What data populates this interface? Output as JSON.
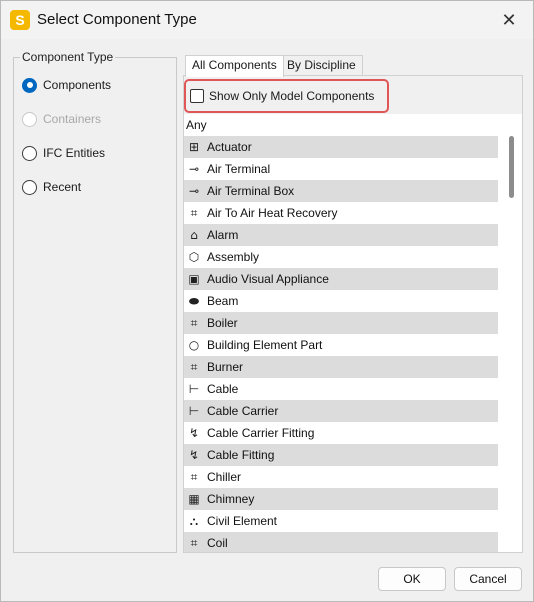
{
  "window": {
    "title": "Select Component Type",
    "app_icon_letter": "S"
  },
  "component_type": {
    "group_title": "Component Type",
    "options": [
      {
        "label": "Components",
        "selected": true,
        "disabled": false
      },
      {
        "label": "Containers",
        "selected": false,
        "disabled": true
      },
      {
        "label": "IFC Entities",
        "selected": false,
        "disabled": false
      },
      {
        "label": "Recent",
        "selected": false,
        "disabled": false
      }
    ]
  },
  "tabs": [
    {
      "label": "All Components",
      "active": true
    },
    {
      "label": "By Discipline",
      "active": false
    }
  ],
  "filter": {
    "show_only_model_label": "Show Only Model Components",
    "checked": false
  },
  "list_items": [
    {
      "label": "Any",
      "icon": ""
    },
    {
      "label": "Actuator",
      "icon": "actuator-icon"
    },
    {
      "label": "Air Terminal",
      "icon": "air-terminal-icon"
    },
    {
      "label": "Air Terminal Box",
      "icon": "air-terminal-box-icon"
    },
    {
      "label": "Air To Air Heat Recovery",
      "icon": "heat-recovery-icon"
    },
    {
      "label": "Alarm",
      "icon": "alarm-icon"
    },
    {
      "label": "Assembly",
      "icon": "assembly-icon"
    },
    {
      "label": "Audio Visual Appliance",
      "icon": "audio-visual-icon"
    },
    {
      "label": "Beam",
      "icon": "beam-icon"
    },
    {
      "label": "Boiler",
      "icon": "boiler-icon"
    },
    {
      "label": "Building Element Part",
      "icon": "circle-icon"
    },
    {
      "label": "Burner",
      "icon": "burner-icon"
    },
    {
      "label": "Cable",
      "icon": "cable-icon"
    },
    {
      "label": "Cable Carrier",
      "icon": "cable-carrier-icon"
    },
    {
      "label": "Cable Carrier Fitting",
      "icon": "cable-carrier-fitting-icon"
    },
    {
      "label": "Cable Fitting",
      "icon": "cable-fitting-icon"
    },
    {
      "label": "Chiller",
      "icon": "chiller-icon"
    },
    {
      "label": "Chimney",
      "icon": "chimney-icon"
    },
    {
      "label": "Civil Element",
      "icon": "civil-element-icon"
    },
    {
      "label": "Coil",
      "icon": "coil-icon"
    }
  ],
  "buttons": {
    "ok": "OK",
    "cancel": "Cancel"
  },
  "colors": {
    "accent": "#0067c0",
    "highlight": "#e05656",
    "app_icon": "#f5b800"
  }
}
